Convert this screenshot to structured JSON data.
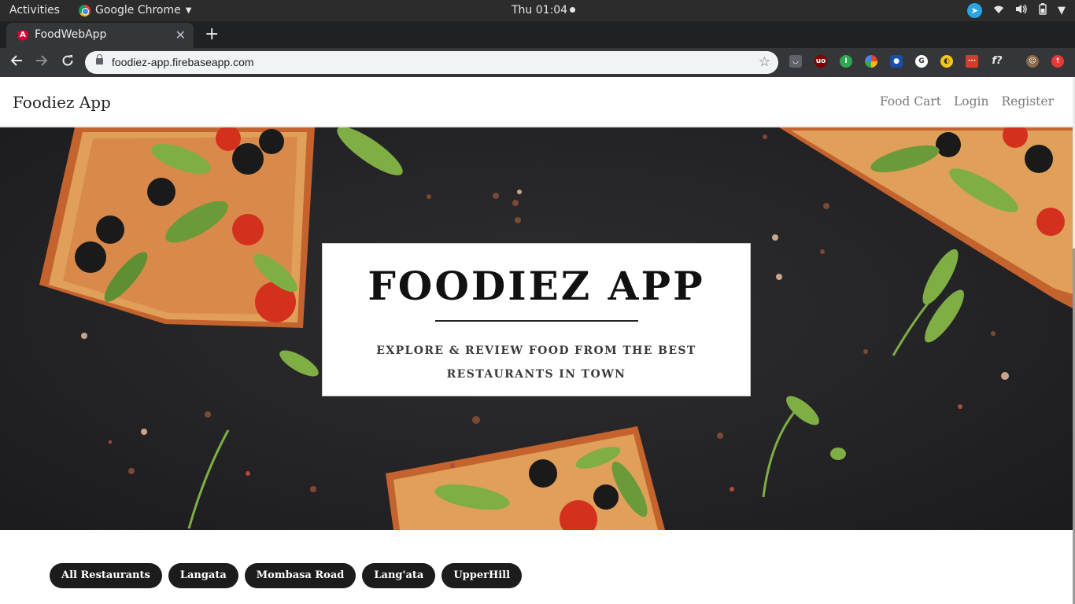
{
  "os_bar": {
    "activities": "Activities",
    "app_name": "Google Chrome",
    "clock": "Thu 01:04"
  },
  "browser": {
    "tab_title": "FoodWebApp",
    "url": "foodiez-app.firebaseapp.com",
    "extensions": [
      "pocket-icon",
      "ublock-icon",
      "extension-green-icon",
      "extension-pinwheel-icon",
      "extension-blue-icon",
      "extension-g-icon",
      "extension-yellow-icon",
      "extension-red-icon",
      "font-finder-icon",
      "profile-avatar",
      "update-icon"
    ]
  },
  "navbar": {
    "brand": "Foodiez App",
    "links": [
      "Food Cart",
      "Login",
      "Register"
    ]
  },
  "hero": {
    "title": "FOODIEZ APP",
    "tagline": "EXPLORE & REVIEW FOOD FROM THE BEST RESTAURANTS IN TOWN"
  },
  "filters": [
    "All Restaurants",
    "Langata",
    "Mombasa Road",
    "Lang'ata",
    "UpperHill"
  ]
}
